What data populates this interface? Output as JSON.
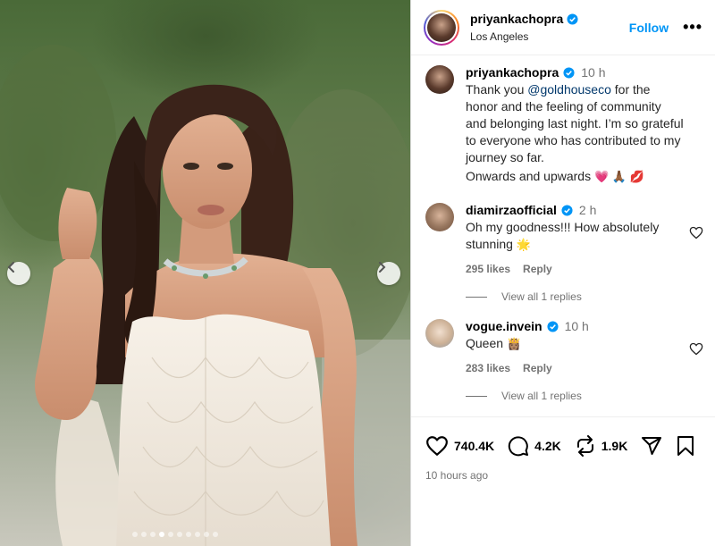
{
  "post": {
    "username": "priyankachopra",
    "location": "Los Angeles",
    "follow_label": "Follow",
    "more_label": "•••",
    "caption_time": "10 h",
    "caption_lines": {
      "pre": "Thank you ",
      "mention": "@goldhouseco",
      "post": " for the honor and the feeling of community and belonging last night. I’m so grateful to everyone who has contributed to my journey so far.",
      "last": "Onwards and upwards",
      "emojis": "💗 🙏🏾 💋"
    },
    "likes": "740.4K",
    "comments_count": "4.2K",
    "reposts": "1.9K",
    "posted_ago": "10 hours ago",
    "carousel": {
      "total": 10,
      "active_index": 3
    }
  },
  "comments": [
    {
      "username": "diamirzaofficial",
      "time": "2 h",
      "text": "Oh my goodness!!! How absolutely stunning",
      "emoji": "🌟",
      "likes": "295 likes",
      "reply_label": "Reply",
      "view_replies": "View all 1 replies"
    },
    {
      "username": "vogue.invein",
      "time": "10 h",
      "text": "Queen",
      "emoji": "👸🏽",
      "likes": "283 likes",
      "reply_label": "Reply",
      "view_replies": "View all 1 replies"
    }
  ],
  "icons": {
    "verified": "verified-badge-icon",
    "like": "heart-icon",
    "comment": "speech-bubble-icon",
    "repost": "repost-icon",
    "share": "paper-plane-icon",
    "save": "bookmark-icon"
  },
  "colors": {
    "accent": "#0095f6",
    "mention": "#00376b",
    "muted": "#737373",
    "border": "#dbdbdb"
  }
}
